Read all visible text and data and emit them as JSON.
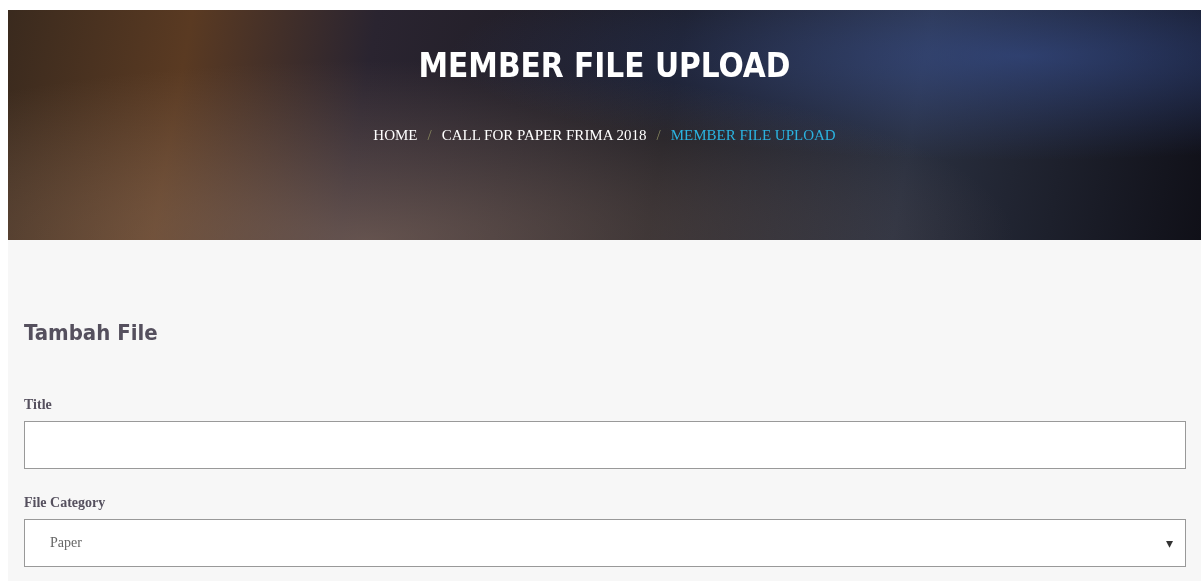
{
  "banner": {
    "title": "MEMBER FILE UPLOAD",
    "separator": "/",
    "breadcrumb": [
      {
        "label": "HOME",
        "selected": false
      },
      {
        "label": "CALL FOR PAPER FRIMA 2018",
        "selected": false
      },
      {
        "label": "MEMBER FILE UPLOAD",
        "selected": true
      }
    ]
  },
  "form": {
    "heading": "Tambah File",
    "fields": [
      {
        "kind": "text",
        "label": "Title"
      },
      {
        "kind": "select",
        "label": "File Category",
        "value": "Paper",
        "caret": "▾"
      }
    ]
  }
}
